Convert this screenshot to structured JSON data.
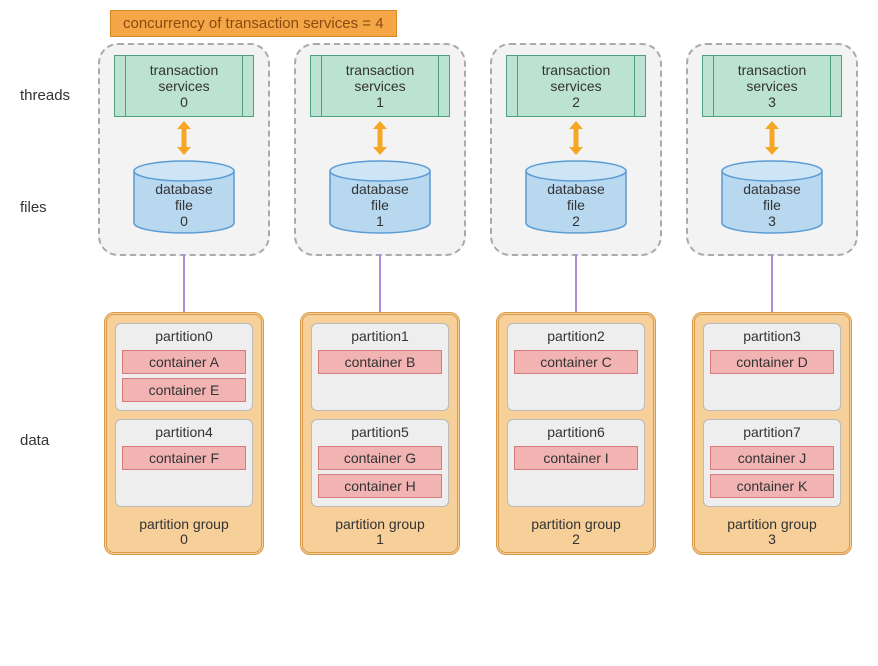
{
  "banner": "concurrency of transaction services = 4",
  "labels": {
    "threads": "threads",
    "files": "files",
    "data": "data"
  },
  "svc_label_top": "transaction",
  "svc_label_mid": "services",
  "db_label_top": "database",
  "db_label_mid": "file",
  "columns": [
    {
      "svc_idx": "0",
      "db_idx": "0",
      "pg_lines": [
        "partition group",
        "0"
      ],
      "partitions": [
        {
          "title": "partition0",
          "containers": [
            "container A",
            "container E"
          ]
        },
        {
          "title": "partition4",
          "containers": [
            "container F"
          ]
        }
      ]
    },
    {
      "svc_idx": "1",
      "db_idx": "1",
      "pg_lines": [
        "partition group",
        "1"
      ],
      "partitions": [
        {
          "title": "partition1",
          "containers": [
            "container B"
          ]
        },
        {
          "title": "partition5",
          "containers": [
            "container G",
            "container H"
          ]
        }
      ]
    },
    {
      "svc_idx": "2",
      "db_idx": "2",
      "pg_lines": [
        "partition group",
        "2"
      ],
      "partitions": [
        {
          "title": "partition2",
          "containers": [
            "container C"
          ]
        },
        {
          "title": "partition6",
          "containers": [
            "container I"
          ]
        }
      ]
    },
    {
      "svc_idx": "3",
      "db_idx": "3",
      "pg_lines": [
        "partition group",
        "3"
      ],
      "partitions": [
        {
          "title": "partition3",
          "containers": [
            "container D"
          ]
        },
        {
          "title": "partition7",
          "containers": [
            "container J",
            "container K"
          ]
        }
      ]
    }
  ]
}
